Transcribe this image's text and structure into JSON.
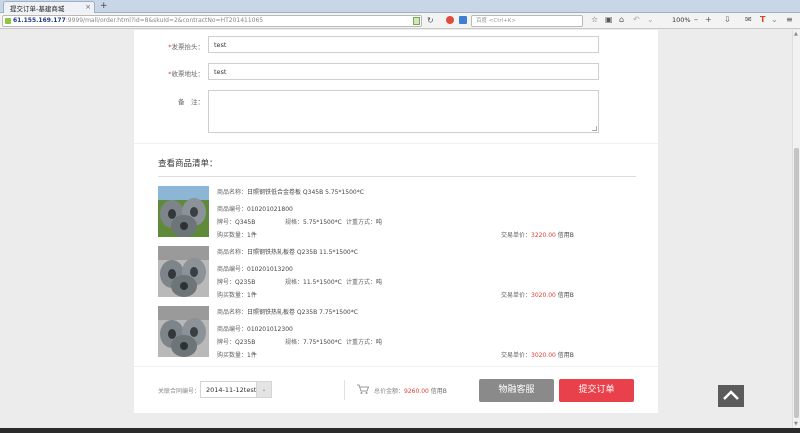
{
  "browser": {
    "tab_title": "提交订单-基建商城",
    "tab_close": "×",
    "new_tab": "+",
    "url_host": "61.155.169.177",
    "url_rest": ":9999/mall/order.html?id=8&skuId=2&contractNo=HT201411065",
    "search_placeholder": "百度 <Ctrl+K>",
    "zoom": "100%"
  },
  "form": {
    "invoice_title": {
      "label": "发票抬头：",
      "required": "*",
      "value": "test"
    },
    "invoice_address": {
      "label": "收票地址：",
      "required": "*",
      "value": "test"
    },
    "remark": {
      "label": "备　注：",
      "value": ""
    }
  },
  "goods": {
    "title": "查看商品清单：",
    "items": [
      {
        "name_label": "商品名称：",
        "name": "日照钢铁低合金卷板 Q345B 5.75*1500*C",
        "code_label": "商品编号：",
        "code": "010201021800",
        "grade_label": "牌号：",
        "grade": "Q345B",
        "spec_label": "规格：",
        "spec": "5.75*1500*C",
        "measure_label": "计重方式：",
        "measure": "吨",
        "qty_label": "购买数量：",
        "qty": "1件",
        "price_label": "交易单价：",
        "price": "3220.00",
        "price_unit": "信用B",
        "image": "steel-coil"
      },
      {
        "name_label": "商品名称：",
        "name": "日照钢铁热轧板卷 Q235B 11.5*1500*C",
        "code_label": "商品编号：",
        "code": "010201013200",
        "grade_label": "牌号：",
        "grade": "Q235B",
        "spec_label": "规格：",
        "spec": "11.5*1500*C",
        "measure_label": "计重方式：",
        "measure": "吨",
        "qty_label": "购买数量：",
        "qty": "1件",
        "price_label": "交易单价：",
        "price": "3020.00",
        "price_unit": "信用B",
        "image": "steel-coil"
      },
      {
        "name_label": "商品名称：",
        "name": "日照钢铁热轧板卷 Q235B 7.75*1500*C",
        "code_label": "商品编号：",
        "code": "010201012300",
        "grade_label": "牌号：",
        "grade": "Q235B",
        "spec_label": "规格：",
        "spec": "7.75*1500*C",
        "measure_label": "计重方式：",
        "measure": "吨",
        "qty_label": "购买数量：",
        "qty": "1件",
        "price_label": "交易单价：",
        "price": "3020.00",
        "price_unit": "信用B",
        "image": "steel-coil"
      }
    ]
  },
  "footer": {
    "contract_label": "关联合同编号：",
    "contract_value": "2014-11-12test",
    "total_label": "总价金额：",
    "total_amount": "9260.00",
    "total_unit": "信用B",
    "service_button": "物融客服",
    "submit_button": "提交订单"
  },
  "colors": {
    "accent_red": "#e8414b",
    "price_red": "#e23a3a",
    "service_grey": "#8a8a8a"
  }
}
